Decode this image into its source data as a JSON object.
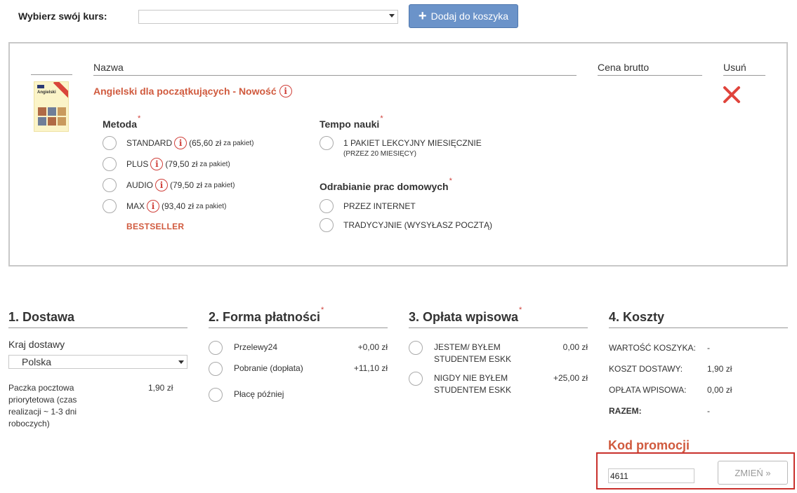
{
  "top": {
    "course_label": "Wybierz swój kurs:",
    "course_value": "",
    "add_button_label": "Dodaj do koszyka"
  },
  "cart": {
    "headers": {
      "name": "Nazwa",
      "price": "Cena brutto",
      "remove": "Usuń"
    },
    "product": {
      "title": "Angielski dla początkujących - Nowość",
      "book_title": "Angielski"
    },
    "method": {
      "title": "Metoda",
      "options": [
        {
          "label": "STANDARD",
          "price": "(65,60 zł",
          "unit": "za pakiet)"
        },
        {
          "label": "PLUS",
          "price": "(79,50 zł",
          "unit": "za pakiet)"
        },
        {
          "label": "AUDIO",
          "price": "(79,50 zł",
          "unit": "za pakiet)"
        },
        {
          "label": "MAX",
          "price": "(93,40 zł",
          "unit": "za pakiet)"
        }
      ],
      "bestseller": "BESTSELLER"
    },
    "tempo": {
      "title": "Tempo nauki",
      "option_label": "1 PAKIET LEKCYJNY MIESIĘCZNIE",
      "option_sub": "(PRZEZ 20 MIESIĘCY)"
    },
    "homework": {
      "title": "Odrabianie prac domowych",
      "options": [
        "PRZEZ INTERNET",
        "TRADYCYJNIE (WYSYŁASZ POCZTĄ)"
      ]
    },
    "required_mark": "*",
    "info_glyph": "i"
  },
  "delivery": {
    "title": "1. Dostawa",
    "country_label": "Kraj dostawy",
    "country_value": "Polska",
    "package_text": "Paczka pocztowa priorytetowa (czas realizacji ~ 1-3 dni roboczych)",
    "package_price": "1,90 zł"
  },
  "payment": {
    "title": "2. Forma płatności",
    "options": [
      {
        "label": "Przelewy24",
        "price": "+0,00 zł"
      },
      {
        "label": "Pobranie (dopłata)",
        "price": "+11,10 zł"
      },
      {
        "label": "Płacę później",
        "price": ""
      }
    ]
  },
  "fee": {
    "title": "3. Opłata wpisowa",
    "options": [
      {
        "label": "JESTEM/ BYŁEM STUDENTEM ESKK",
        "price": "0,00 zł"
      },
      {
        "label": "NIGDY NIE BYŁEM STUDENTEM ESKK",
        "price": "+25,00 zł"
      }
    ]
  },
  "costs": {
    "title": "4. Koszty",
    "rows": [
      {
        "label": "WARTOŚĆ KOSZYKA:",
        "value": "-"
      },
      {
        "label": "KOSZT DOSTAWY:",
        "value": "1,90 zł"
      },
      {
        "label": "OPŁATA WPISOWA:",
        "value": "0,00 zł"
      },
      {
        "label": "RAZEM:",
        "value": "-"
      }
    ]
  },
  "promo": {
    "title": "Kod promocji",
    "code_value": "4611",
    "button_label": "ZMIEŃ »"
  },
  "colors": {
    "accent_red": "#d05a3e",
    "button_blue": "#6b93c9",
    "highlight_border": "#c9302c"
  }
}
